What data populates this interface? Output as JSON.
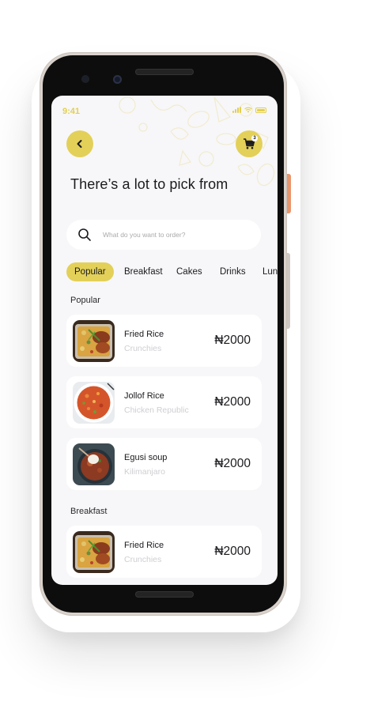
{
  "status": {
    "time": "9:41"
  },
  "header": {
    "back_icon": "chevron-left-icon",
    "cart_icon": "cart-icon",
    "cart_count": "3"
  },
  "headline": "There’s a lot to pick from",
  "search": {
    "placeholder": "What do you want to order?"
  },
  "categories": [
    "Popular",
    "Breakfast",
    "Cakes",
    "Drinks",
    "Lun"
  ],
  "sections": [
    {
      "title": "Popular",
      "items": [
        {
          "name": "Fried Rice",
          "vendor": "Crunchies",
          "price": "₦2000"
        },
        {
          "name": "Jollof Rice",
          "vendor": "Chicken Republic",
          "price": "₦2000"
        },
        {
          "name": "Egusi soup",
          "vendor": "Kilimanjaro",
          "price": "₦2000"
        }
      ]
    },
    {
      "title": "Breakfast",
      "items": [
        {
          "name": "Fried Rice",
          "vendor": "Crunchies",
          "price": "₦2000"
        }
      ]
    }
  ],
  "colors": {
    "accent": "#e3d059",
    "background": "#f7f7f9",
    "card": "#ffffff",
    "muted": "#cfcfd4"
  }
}
